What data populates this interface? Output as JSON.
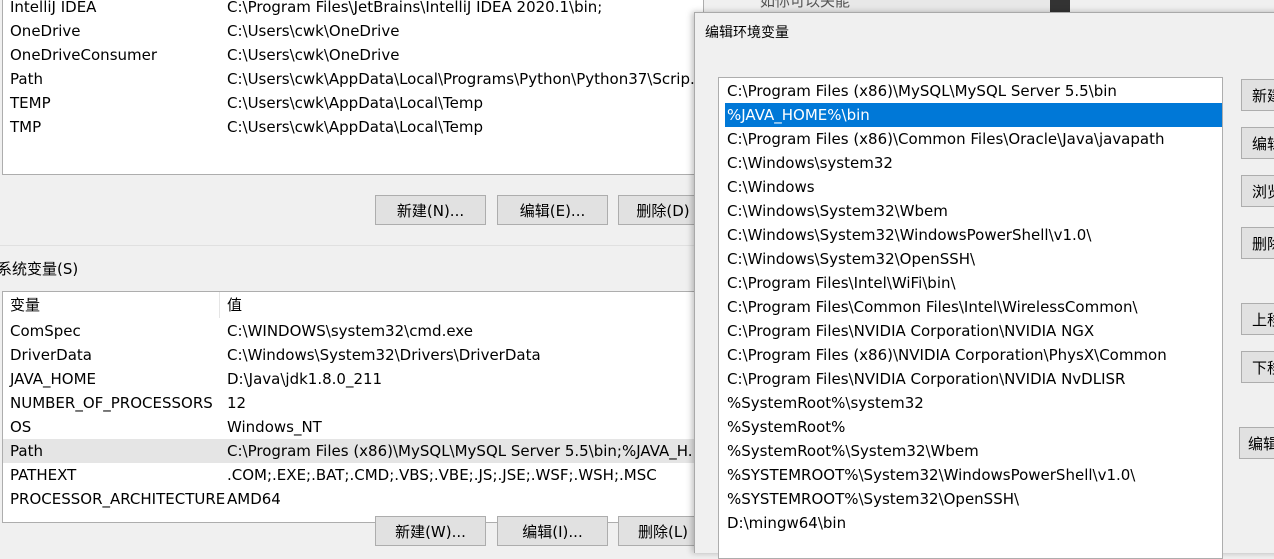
{
  "user_vars": [
    {
      "name": "IntelliJ IDEA",
      "value": "C:\\Program Files\\JetBrains\\IntelliJ IDEA 2020.1\\bin;"
    },
    {
      "name": "OneDrive",
      "value": "C:\\Users\\cwk\\OneDrive"
    },
    {
      "name": "OneDriveConsumer",
      "value": "C:\\Users\\cwk\\OneDrive"
    },
    {
      "name": "Path",
      "value": "C:\\Users\\cwk\\AppData\\Local\\Programs\\Python\\Python37\\Scrip..."
    },
    {
      "name": "TEMP",
      "value": "C:\\Users\\cwk\\AppData\\Local\\Temp"
    },
    {
      "name": "TMP",
      "value": "C:\\Users\\cwk\\AppData\\Local\\Temp"
    }
  ],
  "user_buttons": {
    "new": "新建(N)...",
    "edit": "编辑(E)...",
    "delete": "删除(D)"
  },
  "system_section_label": "系统变量(S)",
  "system_columns": {
    "name": "变量",
    "value": "值"
  },
  "system_vars": [
    {
      "name": "ComSpec",
      "value": "C:\\WINDOWS\\system32\\cmd.exe"
    },
    {
      "name": "DriverData",
      "value": "C:\\Windows\\System32\\Drivers\\DriverData"
    },
    {
      "name": "JAVA_HOME",
      "value": "D:\\Java\\jdk1.8.0_211"
    },
    {
      "name": "NUMBER_OF_PROCESSORS",
      "value": "12"
    },
    {
      "name": "OS",
      "value": "Windows_NT"
    },
    {
      "name": "Path",
      "value": "C:\\Program Files (x86)\\MySQL\\MySQL Server 5.5\\bin;%JAVA_H..."
    },
    {
      "name": "PATHEXT",
      "value": ".COM;.EXE;.BAT;.CMD;.VBS;.VBE;.JS;.JSE;.WSF;.WSH;.MSC"
    },
    {
      "name": "PROCESSOR_ARCHITECTURE",
      "value": "AMD64"
    }
  ],
  "system_buttons": {
    "new": "新建(W)...",
    "edit": "编辑(I)...",
    "delete": "删除(L)"
  },
  "edit_dialog": {
    "title": "编辑环境变量",
    "selected_index": 1,
    "paths": [
      "C:\\Program Files (x86)\\MySQL\\MySQL Server 5.5\\bin",
      "%JAVA_HOME%\\bin",
      "C:\\Program Files (x86)\\Common Files\\Oracle\\Java\\javapath",
      "C:\\Windows\\system32",
      "C:\\Windows",
      "C:\\Windows\\System32\\Wbem",
      "C:\\Windows\\System32\\WindowsPowerShell\\v1.0\\",
      "C:\\Windows\\System32\\OpenSSH\\",
      "C:\\Program Files\\Intel\\WiFi\\bin\\",
      "C:\\Program Files\\Common Files\\Intel\\WirelessCommon\\",
      "C:\\Program Files\\NVIDIA Corporation\\NVIDIA NGX",
      "C:\\Program Files (x86)\\NVIDIA Corporation\\PhysX\\Common",
      "C:\\Program Files\\NVIDIA Corporation\\NVIDIA NvDLISR",
      "%SystemRoot%\\system32",
      "%SystemRoot%",
      "%SystemRoot%\\System32\\Wbem",
      "%SYSTEMROOT%\\System32\\WindowsPowerShell\\v1.0\\",
      "%SYSTEMROOT%\\System32\\OpenSSH\\",
      "D:\\mingw64\\bin"
    ],
    "side_buttons": [
      "新建",
      "编辑",
      "浏览",
      "删除",
      "上移",
      "下移",
      "编辑文本"
    ]
  },
  "background_text": "如你可以关能"
}
